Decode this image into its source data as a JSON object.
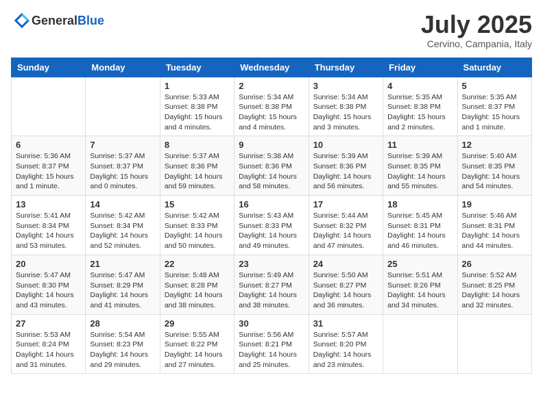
{
  "header": {
    "logo_general": "General",
    "logo_blue": "Blue",
    "month_title": "July 2025",
    "location": "Cervino, Campania, Italy"
  },
  "days_of_week": [
    "Sunday",
    "Monday",
    "Tuesday",
    "Wednesday",
    "Thursday",
    "Friday",
    "Saturday"
  ],
  "weeks": [
    [
      {
        "day": "",
        "info": ""
      },
      {
        "day": "",
        "info": ""
      },
      {
        "day": "1",
        "info": "Sunrise: 5:33 AM\nSunset: 8:38 PM\nDaylight: 15 hours and 4 minutes."
      },
      {
        "day": "2",
        "info": "Sunrise: 5:34 AM\nSunset: 8:38 PM\nDaylight: 15 hours and 4 minutes."
      },
      {
        "day": "3",
        "info": "Sunrise: 5:34 AM\nSunset: 8:38 PM\nDaylight: 15 hours and 3 minutes."
      },
      {
        "day": "4",
        "info": "Sunrise: 5:35 AM\nSunset: 8:38 PM\nDaylight: 15 hours and 2 minutes."
      },
      {
        "day": "5",
        "info": "Sunrise: 5:35 AM\nSunset: 8:37 PM\nDaylight: 15 hours and 1 minute."
      }
    ],
    [
      {
        "day": "6",
        "info": "Sunrise: 5:36 AM\nSunset: 8:37 PM\nDaylight: 15 hours and 1 minute."
      },
      {
        "day": "7",
        "info": "Sunrise: 5:37 AM\nSunset: 8:37 PM\nDaylight: 15 hours and 0 minutes."
      },
      {
        "day": "8",
        "info": "Sunrise: 5:37 AM\nSunset: 8:36 PM\nDaylight: 14 hours and 59 minutes."
      },
      {
        "day": "9",
        "info": "Sunrise: 5:38 AM\nSunset: 8:36 PM\nDaylight: 14 hours and 58 minutes."
      },
      {
        "day": "10",
        "info": "Sunrise: 5:39 AM\nSunset: 8:36 PM\nDaylight: 14 hours and 56 minutes."
      },
      {
        "day": "11",
        "info": "Sunrise: 5:39 AM\nSunset: 8:35 PM\nDaylight: 14 hours and 55 minutes."
      },
      {
        "day": "12",
        "info": "Sunrise: 5:40 AM\nSunset: 8:35 PM\nDaylight: 14 hours and 54 minutes."
      }
    ],
    [
      {
        "day": "13",
        "info": "Sunrise: 5:41 AM\nSunset: 8:34 PM\nDaylight: 14 hours and 53 minutes."
      },
      {
        "day": "14",
        "info": "Sunrise: 5:42 AM\nSunset: 8:34 PM\nDaylight: 14 hours and 52 minutes."
      },
      {
        "day": "15",
        "info": "Sunrise: 5:42 AM\nSunset: 8:33 PM\nDaylight: 14 hours and 50 minutes."
      },
      {
        "day": "16",
        "info": "Sunrise: 5:43 AM\nSunset: 8:33 PM\nDaylight: 14 hours and 49 minutes."
      },
      {
        "day": "17",
        "info": "Sunrise: 5:44 AM\nSunset: 8:32 PM\nDaylight: 14 hours and 47 minutes."
      },
      {
        "day": "18",
        "info": "Sunrise: 5:45 AM\nSunset: 8:31 PM\nDaylight: 14 hours and 46 minutes."
      },
      {
        "day": "19",
        "info": "Sunrise: 5:46 AM\nSunset: 8:31 PM\nDaylight: 14 hours and 44 minutes."
      }
    ],
    [
      {
        "day": "20",
        "info": "Sunrise: 5:47 AM\nSunset: 8:30 PM\nDaylight: 14 hours and 43 minutes."
      },
      {
        "day": "21",
        "info": "Sunrise: 5:47 AM\nSunset: 8:29 PM\nDaylight: 14 hours and 41 minutes."
      },
      {
        "day": "22",
        "info": "Sunrise: 5:48 AM\nSunset: 8:28 PM\nDaylight: 14 hours and 38 minutes."
      },
      {
        "day": "23",
        "info": "Sunrise: 5:49 AM\nSunset: 8:27 PM\nDaylight: 14 hours and 38 minutes."
      },
      {
        "day": "24",
        "info": "Sunrise: 5:50 AM\nSunset: 8:27 PM\nDaylight: 14 hours and 36 minutes."
      },
      {
        "day": "25",
        "info": "Sunrise: 5:51 AM\nSunset: 8:26 PM\nDaylight: 14 hours and 34 minutes."
      },
      {
        "day": "26",
        "info": "Sunrise: 5:52 AM\nSunset: 8:25 PM\nDaylight: 14 hours and 32 minutes."
      }
    ],
    [
      {
        "day": "27",
        "info": "Sunrise: 5:53 AM\nSunset: 8:24 PM\nDaylight: 14 hours and 31 minutes."
      },
      {
        "day": "28",
        "info": "Sunrise: 5:54 AM\nSunset: 8:23 PM\nDaylight: 14 hours and 29 minutes."
      },
      {
        "day": "29",
        "info": "Sunrise: 5:55 AM\nSunset: 8:22 PM\nDaylight: 14 hours and 27 minutes."
      },
      {
        "day": "30",
        "info": "Sunrise: 5:56 AM\nSunset: 8:21 PM\nDaylight: 14 hours and 25 minutes."
      },
      {
        "day": "31",
        "info": "Sunrise: 5:57 AM\nSunset: 8:20 PM\nDaylight: 14 hours and 23 minutes."
      },
      {
        "day": "",
        "info": ""
      },
      {
        "day": "",
        "info": ""
      }
    ]
  ]
}
